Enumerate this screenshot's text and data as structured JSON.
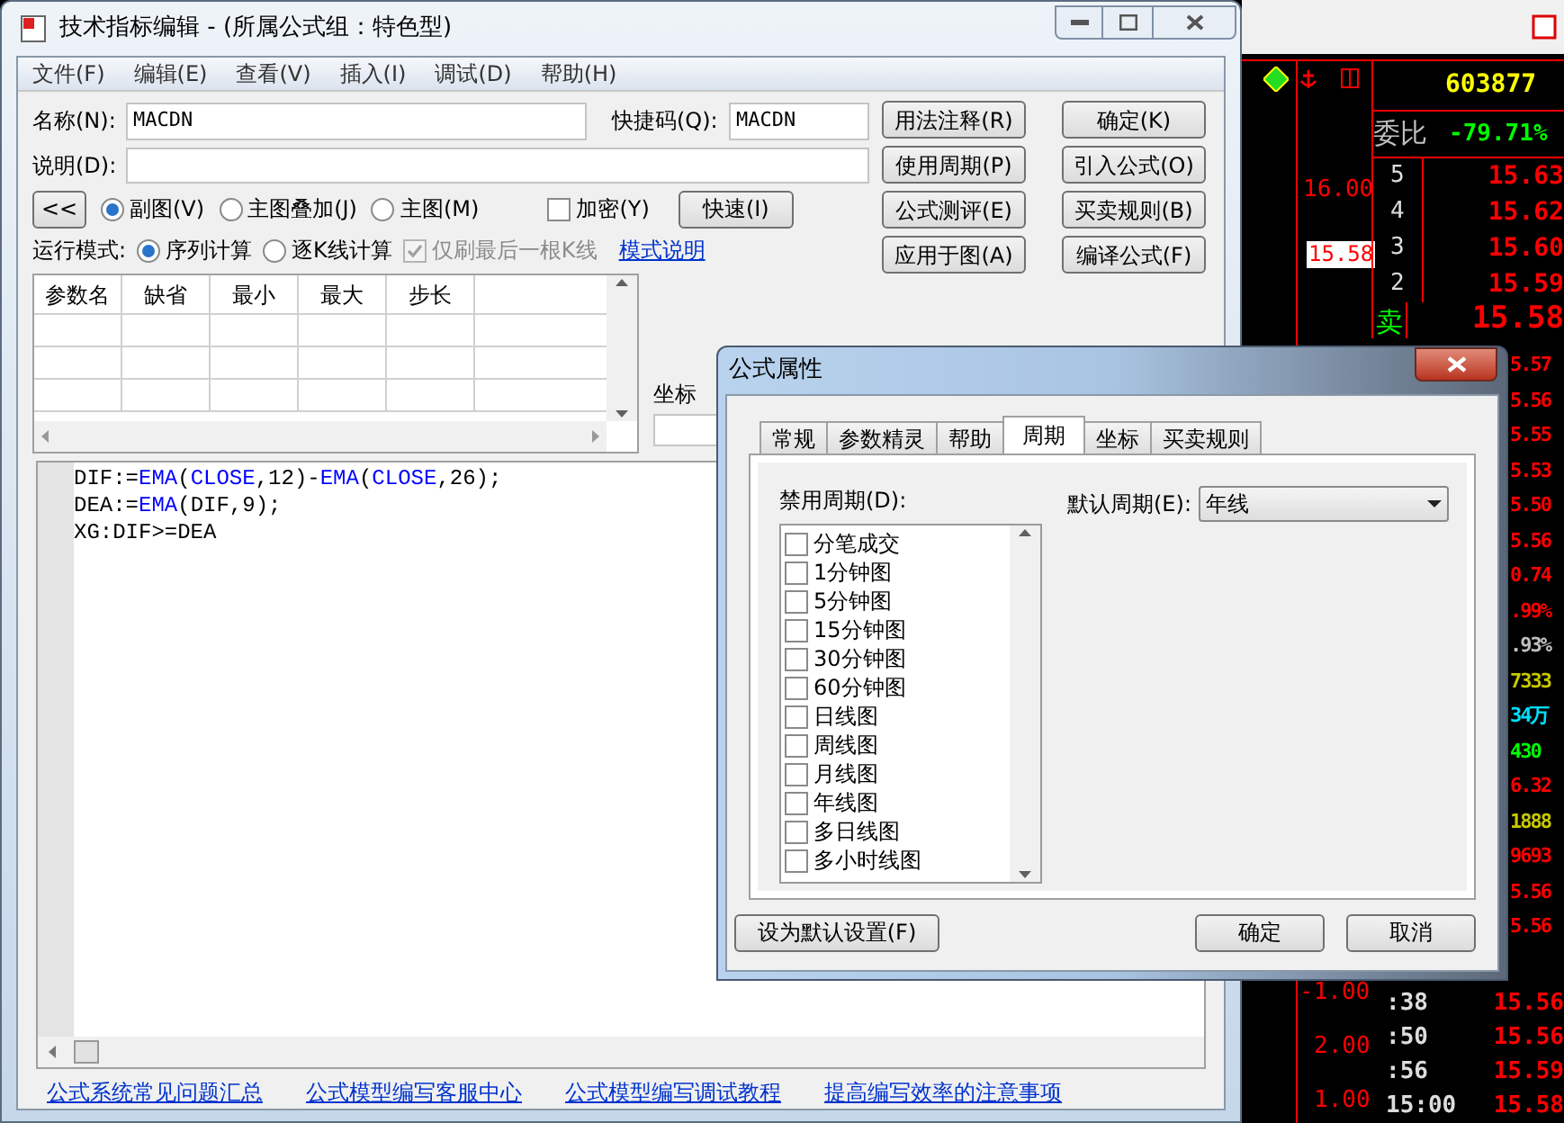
{
  "quote_panel": {
    "code": "603877",
    "ratio_label": "委比",
    "ratio_value": "-79.71%",
    "sell_levels": [
      {
        "level_label": "5",
        "price": "15.63",
        "kind": "number"
      },
      {
        "level_label": "4",
        "price": "15.62",
        "kind": "number"
      },
      {
        "level_label": "3",
        "price": "15.60",
        "kind": "number"
      },
      {
        "level_label": "2",
        "price": "15.59",
        "kind": "number"
      },
      {
        "level_label": "卖",
        "price": "15.58",
        "kind": "word"
      }
    ],
    "side_values": [
      {
        "text": "5.57",
        "color": "#ff0000"
      },
      {
        "text": "5.56",
        "color": "#ff0000"
      },
      {
        "text": "5.55",
        "color": "#ff0000"
      },
      {
        "text": "5.53",
        "color": "#ff0000"
      },
      {
        "text": "5.50",
        "color": "#ff0000"
      },
      {
        "text": "5.56",
        "color": "#ff0000"
      },
      {
        "text": "0.74",
        "color": "#ff0000"
      },
      {
        "text": ".99%",
        "color": "#ff0000"
      },
      {
        "text": ".93%",
        "color": "#c0c0c0"
      },
      {
        "text": "7333",
        "color": "#c8c800"
      },
      {
        "text": "34万",
        "color": "#00e0ff"
      },
      {
        "text": "430",
        "color": "#00ff00"
      },
      {
        "text": "6.32",
        "color": "#ff0000"
      },
      {
        "text": "1888",
        "color": "#c8c800"
      },
      {
        "text": "9693",
        "color": "#ff0000"
      },
      {
        "text": "5.56",
        "color": "#ff0000"
      },
      {
        "text": "5.56",
        "color": "#ff0000"
      }
    ],
    "trades": [
      {
        "time": ":38",
        "price": "15.56"
      },
      {
        "time": ":50",
        "price": "15.56"
      },
      {
        "time": ":56",
        "price": "15.59"
      },
      {
        "time": "15:00",
        "price": "15.58"
      }
    ]
  },
  "chart": {
    "price_labels": [
      "16.00"
    ],
    "current_price": "15.58",
    "volume_labels": [
      "-1.00",
      "2.00",
      "1.00"
    ]
  },
  "window": {
    "title": "技术指标编辑 - (所属公式组：特色型)",
    "menu": [
      "文件(F)",
      "编辑(E)",
      "查看(V)",
      "插入(I)",
      "调试(D)",
      "帮助(H)"
    ],
    "name_label": "名称(N):",
    "name_value": "MACDN",
    "shortcut_label": "快捷码(Q):",
    "shortcut_value": "MACDN",
    "description_label": "说明(D):",
    "buttons": [
      "用法注释(R)",
      "确定(K)",
      "使用周期(P)",
      "引入公式(O)",
      "公式测评(E)",
      "买卖规则(B)",
      "应用于图(A)",
      "编译公式(F)"
    ],
    "collapse_button": "<<",
    "chart_types": [
      {
        "label": "副图(V)",
        "selected": true
      },
      {
        "label": "主图叠加(J)",
        "selected": false
      },
      {
        "label": "主图(M)",
        "selected": false
      }
    ],
    "encrypt": {
      "label": "加密(Y)",
      "checked": false
    },
    "quick_button": "快速(I)",
    "run_mode_label": "运行模式:",
    "run_modes": [
      {
        "label": "序列计算",
        "selected": true
      },
      {
        "label": "逐K线计算",
        "selected": false
      }
    ],
    "refresh_last": {
      "label": "仅刷最后一根K线",
      "checked": true,
      "disabled": true
    },
    "mode_link": "模式说明",
    "param_columns": [
      "参数名",
      "缺省",
      "最小",
      "最大",
      "步长"
    ],
    "axis_label": "坐标",
    "code": [
      [
        {
          "text": "DIF:=",
          "kind": "plain"
        },
        {
          "text": "EMA",
          "kind": "keyword"
        },
        {
          "text": "(",
          "kind": "plain"
        },
        {
          "text": "CLOSE",
          "kind": "keyword"
        },
        {
          "text": ",12)-",
          "kind": "plain"
        },
        {
          "text": "EMA",
          "kind": "keyword"
        },
        {
          "text": "(",
          "kind": "plain"
        },
        {
          "text": "CLOSE",
          "kind": "keyword"
        },
        {
          "text": ",26);",
          "kind": "plain"
        }
      ],
      [
        {
          "text": "DEA:=",
          "kind": "plain"
        },
        {
          "text": "EMA",
          "kind": "keyword"
        },
        {
          "text": "(DIF,9);",
          "kind": "plain"
        }
      ],
      [
        {
          "text": "XG:DIF>=DEA",
          "kind": "plain"
        }
      ]
    ],
    "links": [
      "公式系统常见问题汇总",
      "公式模型编写客服中心",
      "公式模型编写调试教程",
      "提高编写效率的注意事项"
    ]
  },
  "dialog": {
    "title": "公式属性",
    "tabs": [
      {
        "label": "常规",
        "selected": false
      },
      {
        "label": "参数精灵",
        "selected": false
      },
      {
        "label": "帮助",
        "selected": false
      },
      {
        "label": "周期",
        "selected": true
      },
      {
        "label": "坐标",
        "selected": false
      },
      {
        "label": "买卖规则",
        "selected": false
      }
    ],
    "disabled_periods_label": "禁用周期(D):",
    "periods": [
      {
        "label": "分笔成交",
        "checked": false
      },
      {
        "label": "1分钟图",
        "checked": false
      },
      {
        "label": "5分钟图",
        "checked": false
      },
      {
        "label": "15分钟图",
        "checked": false
      },
      {
        "label": "30分钟图",
        "checked": false
      },
      {
        "label": "60分钟图",
        "checked": false
      },
      {
        "label": "日线图",
        "checked": false
      },
      {
        "label": "周线图",
        "checked": false
      },
      {
        "label": "月线图",
        "checked": false
      },
      {
        "label": "年线图",
        "checked": false
      },
      {
        "label": "多日线图",
        "checked": false
      },
      {
        "label": "多小时线图",
        "checked": false
      }
    ],
    "default_period_label": "默认周期(E):",
    "default_period_value": "年线",
    "set_default_button": "设为默认设置(F)",
    "ok_button": "确定",
    "cancel_button": "取消"
  }
}
